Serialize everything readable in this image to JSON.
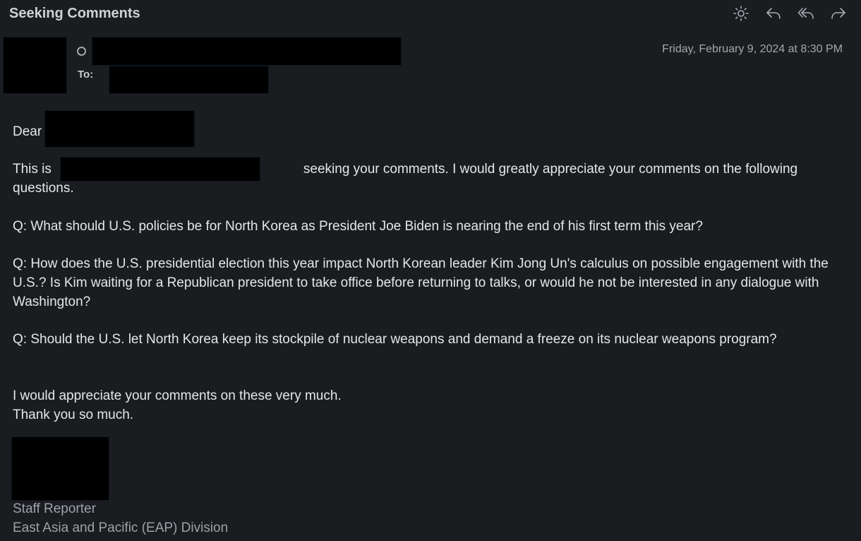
{
  "email": {
    "subject": "Seeking Comments",
    "to_label": "To:",
    "date": "Friday, February 9, 2024 at 8:30 PM",
    "greeting": "Dear",
    "intro_before": "This is",
    "intro_after": "seeking your comments. I would greatly appreciate your comments on the following questions.",
    "questions": [
      "Q: What should U.S. policies be for North Korea as President Joe Biden is nearing the end of his first term this year?",
      "Q: How does the U.S. presidential election this year impact North Korean leader Kim Jong Un's calculus on possible engagement with the U.S.? Is Kim waiting for a Republican president to take office before returning to talks, or would he not be interested in any dialogue with Washington?",
      "Q: Should the U.S. let North Korea keep its stockpile of nuclear weapons and demand a freeze on its nuclear weapons program?"
    ],
    "closing_1": "I would appreciate your comments on these very much.",
    "closing_2": "Thank you so much.",
    "signature_title": "Staff Reporter",
    "signature_division": "East Asia and Pacific (EAP) Division"
  },
  "toolbar": {
    "icons": [
      "appearance-icon",
      "reply-icon",
      "reply-all-icon",
      "forward-icon"
    ]
  },
  "colors": {
    "background": "#1b1c20",
    "text": "#e4e6ea",
    "muted": "#a4a7ae",
    "redaction": "#000000"
  }
}
